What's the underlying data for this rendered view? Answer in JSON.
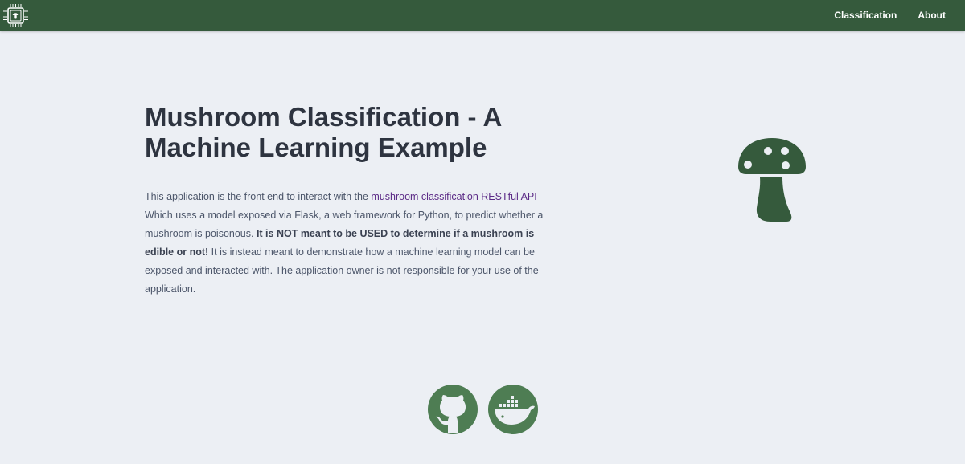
{
  "header": {
    "logo_icon": "mushroom-chip-logo-icon",
    "nav": [
      {
        "label": "Classification"
      },
      {
        "label": "About"
      }
    ],
    "bg_color": "#355a3c"
  },
  "main": {
    "title": "Mushroom Classification - A Machine Learning Example",
    "intro_text": "This application is the front end to interact with the ",
    "api_link_text": "mushroom classification RESTful API",
    "body_text_1": " Which uses a model exposed via Flask, a web framework for Python, to predict whether a mushroom is poisonous. ",
    "warning_text": "It is NOT meant to be USED to determine if a mushroom is edible or not!",
    "body_text_2": " It is instead meant to demonstrate how a machine learning model can be exposed and interacted with. The application owner is not responsible for your use of the application.",
    "hero_icon": "mushroom-icon",
    "accent_color": "#355a3c"
  },
  "footer": {
    "icons": [
      "github-icon",
      "docker-icon"
    ],
    "icon_color": "#4e7d53"
  }
}
